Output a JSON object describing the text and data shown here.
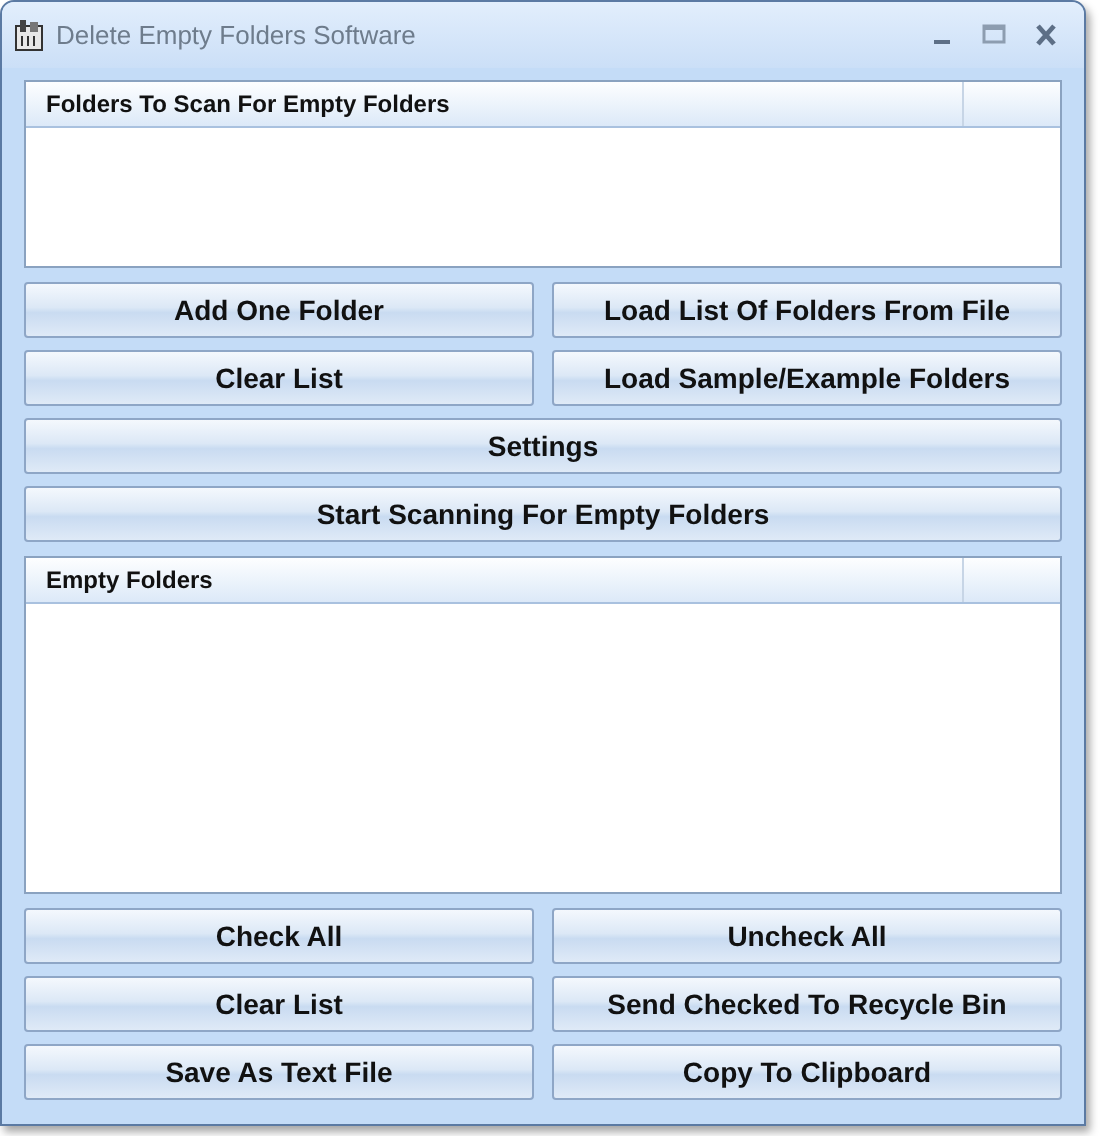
{
  "window": {
    "title": "Delete Empty Folders Software"
  },
  "sections": [
    {
      "kind": "list",
      "header": "Folders To Scan For Empty Folders"
    },
    {
      "kind": "buttons",
      "rows": [
        [
          "Add One Folder",
          "Load List Of Folders From File"
        ],
        [
          "Clear List",
          "Load Sample/Example Folders"
        ],
        [
          "Settings"
        ],
        [
          "Start Scanning For Empty Folders"
        ]
      ]
    },
    {
      "kind": "list",
      "header": "Empty Folders"
    },
    {
      "kind": "buttons",
      "rows": [
        [
          "Check All",
          "Uncheck All"
        ],
        [
          "Clear List",
          "Send Checked To Recycle Bin"
        ],
        [
          "Save As Text File",
          "Copy To Clipboard"
        ]
      ]
    }
  ]
}
